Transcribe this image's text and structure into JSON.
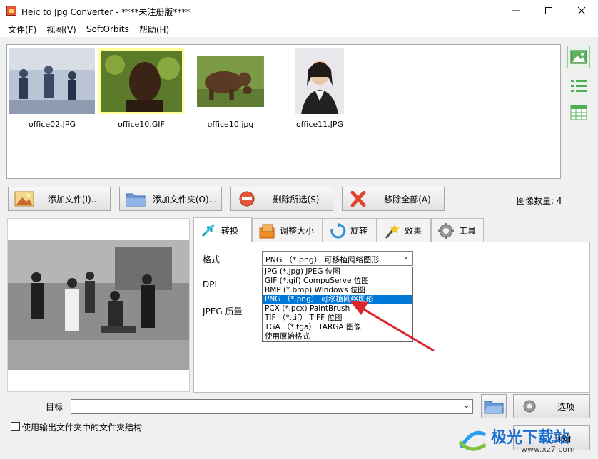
{
  "window": {
    "title": "Heic to Jpg Converter - ****未注册版****"
  },
  "menu": [
    "文件(F)",
    "视图(V)",
    "SoftOrbits",
    "帮助(H)"
  ],
  "thumbnails": [
    {
      "name": "office02.JPG"
    },
    {
      "name": "office10.GIF"
    },
    {
      "name": "office10.jpg"
    },
    {
      "name": "office11.JPG"
    }
  ],
  "toolbar": {
    "add_files": "添加文件(I)...",
    "add_folder": "添加文件夹(O)...",
    "remove_selected": "删除所选(S)",
    "remove_all": "移除全部(A)",
    "image_count": "图像数量: 4"
  },
  "tabs": [
    {
      "label": "转换",
      "icon": "convert-arrow-icon"
    },
    {
      "label": "调整大小",
      "icon": "resize-icon"
    },
    {
      "label": "旋转",
      "icon": "rotate-icon"
    },
    {
      "label": "效果",
      "icon": "magic-wand-icon"
    },
    {
      "label": "工具",
      "icon": "gear-icon"
    }
  ],
  "convert": {
    "format_label": "格式",
    "dpi_label": "DPI",
    "jpeg_quality_label": "JPEG 质量",
    "format_selected": "PNG （*.png） 可移植网络图形",
    "format_options": [
      "JPG (*.jpg) JPEG 位图",
      "GIF (*.gif) CompuServe 位图",
      "BMP (*.bmp) Windows 位图",
      "PNG （*.png） 可移植网络图形",
      "PCX (*.pcx) PaintBrush",
      "TIF （*.tif） TIFF 位图",
      "TGA （*.tga） TARGA 图像",
      "使用原始格式"
    ],
    "selected_index": 3
  },
  "bottom": {
    "target_label": "目标",
    "target_value": "",
    "options_button": "选项",
    "start_button": "开始",
    "keep_structure_label": "使用输出文件夹中的文件夹结构",
    "keep_structure_checked": false
  },
  "watermark": {
    "text": "极光下载站",
    "url": "www.xz7.com"
  },
  "colors": {
    "accent": "#0078d7",
    "selection_yellow": "#ffff99",
    "arrow_red": "#d9262b"
  }
}
